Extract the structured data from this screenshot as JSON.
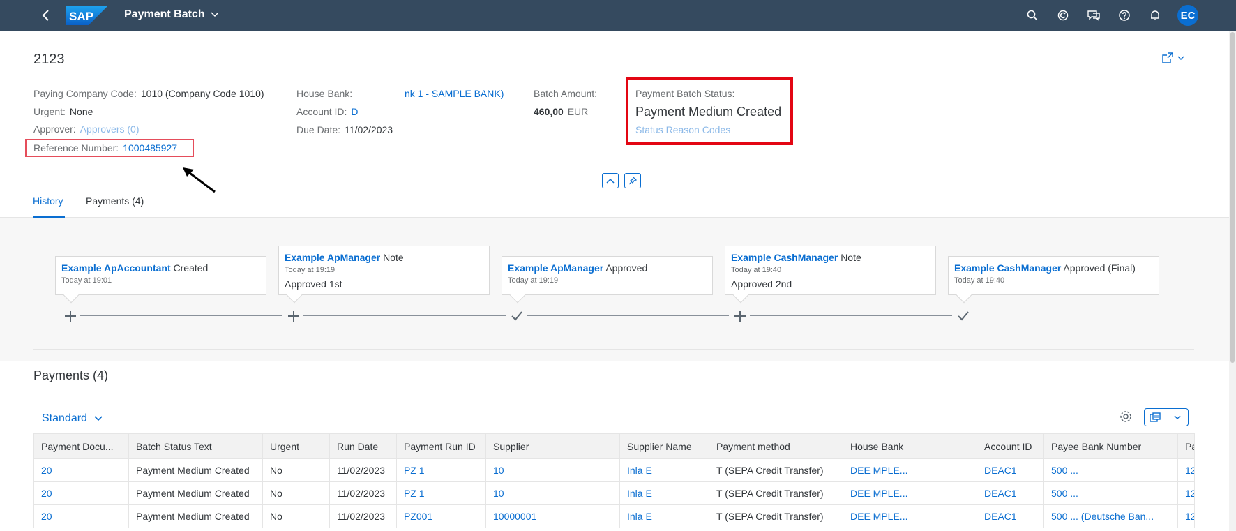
{
  "shell": {
    "logo_text": "SAP",
    "app_title": "Payment Batch",
    "avatar_initials": "EC"
  },
  "header": {
    "object_id": "2123",
    "paying_company_code_label": "Paying Company Code:",
    "paying_company_code_value": "1010 (Company Code 1010)",
    "urgent_label": "Urgent:",
    "urgent_value": "None",
    "approver_label": "Approver:",
    "approver_value": "Approvers (0)",
    "reference_label": "Reference Number:",
    "reference_value": "1000485927",
    "house_bank_label": "House Bank:",
    "house_bank_value": "nk 1 - SAMPLE BANK)",
    "account_id_label": "Account ID:",
    "account_id_value": "D",
    "due_date_label": "Due Date:",
    "due_date_value": "11/02/2023",
    "batch_amount_label": "Batch Amount:",
    "batch_amount_value": "460,00",
    "batch_amount_currency": "EUR",
    "status_label": "Payment Batch Status:",
    "status_value": "Payment Medium Created",
    "status_reason_link": "Status Reason Codes"
  },
  "tabs": [
    {
      "label": "History",
      "active": true
    },
    {
      "label": "Payments (4)",
      "active": false
    }
  ],
  "history": [
    {
      "who": "Example ApAccountant",
      "action": "Created",
      "when": "Today at 19:01",
      "note": "",
      "icon": "plus-icon"
    },
    {
      "who": "Example ApManager",
      "action": "Note",
      "when": "Today at 19:19",
      "note": "Approved 1st",
      "icon": "plus-icon"
    },
    {
      "who": "Example ApManager",
      "action": "Approved",
      "when": "Today at 19:19",
      "note": "",
      "icon": "check-icon"
    },
    {
      "who": "Example CashManager",
      "action": "Note",
      "when": "Today at 19:40",
      "note": "Approved 2nd",
      "icon": "plus-icon"
    },
    {
      "who": "Example CashManager",
      "action": "Approved (Final)",
      "when": "Today at 19:40",
      "note": "",
      "icon": "check-icon"
    }
  ],
  "payments": {
    "title": "Payments (4)",
    "variant": "Standard",
    "columns": [
      "Payment Docu...",
      "Batch Status Text",
      "Urgent",
      "Run Date",
      "Payment Run ID",
      "Supplier",
      "Supplier Name",
      "Payment method",
      "House Bank",
      "Account ID",
      "Payee Bank Number",
      "Pa"
    ],
    "rows": [
      [
        "20",
        "Payment Medium Created",
        "No",
        "11/02/2023",
        "PZ       1",
        "10",
        "Inla                E",
        "T (SEPA Credit Transfer)",
        "DEE                   MPLE...",
        "DEAC1",
        "500                         ...",
        "12"
      ],
      [
        "20",
        "Payment Medium Created",
        "No",
        "11/02/2023",
        "PZ       1",
        "10",
        "Inla                E",
        "T (SEPA Credit Transfer)",
        "DEE                   MPLE...",
        "DEAC1",
        "500                         ...",
        "12"
      ],
      [
        "20",
        "Payment Medium Created",
        "No",
        "11/02/2023",
        "PZ001",
        "10000001",
        "Inla                E",
        "T (SEPA Credit Transfer)",
        "DEE                   MPLE...",
        "DEAC1",
        "500 ... (Deutsche Ban...",
        "12"
      ]
    ]
  },
  "colors": {
    "shell": "#354a5f",
    "link": "#0a6ed1",
    "highlight": "#e30613"
  }
}
